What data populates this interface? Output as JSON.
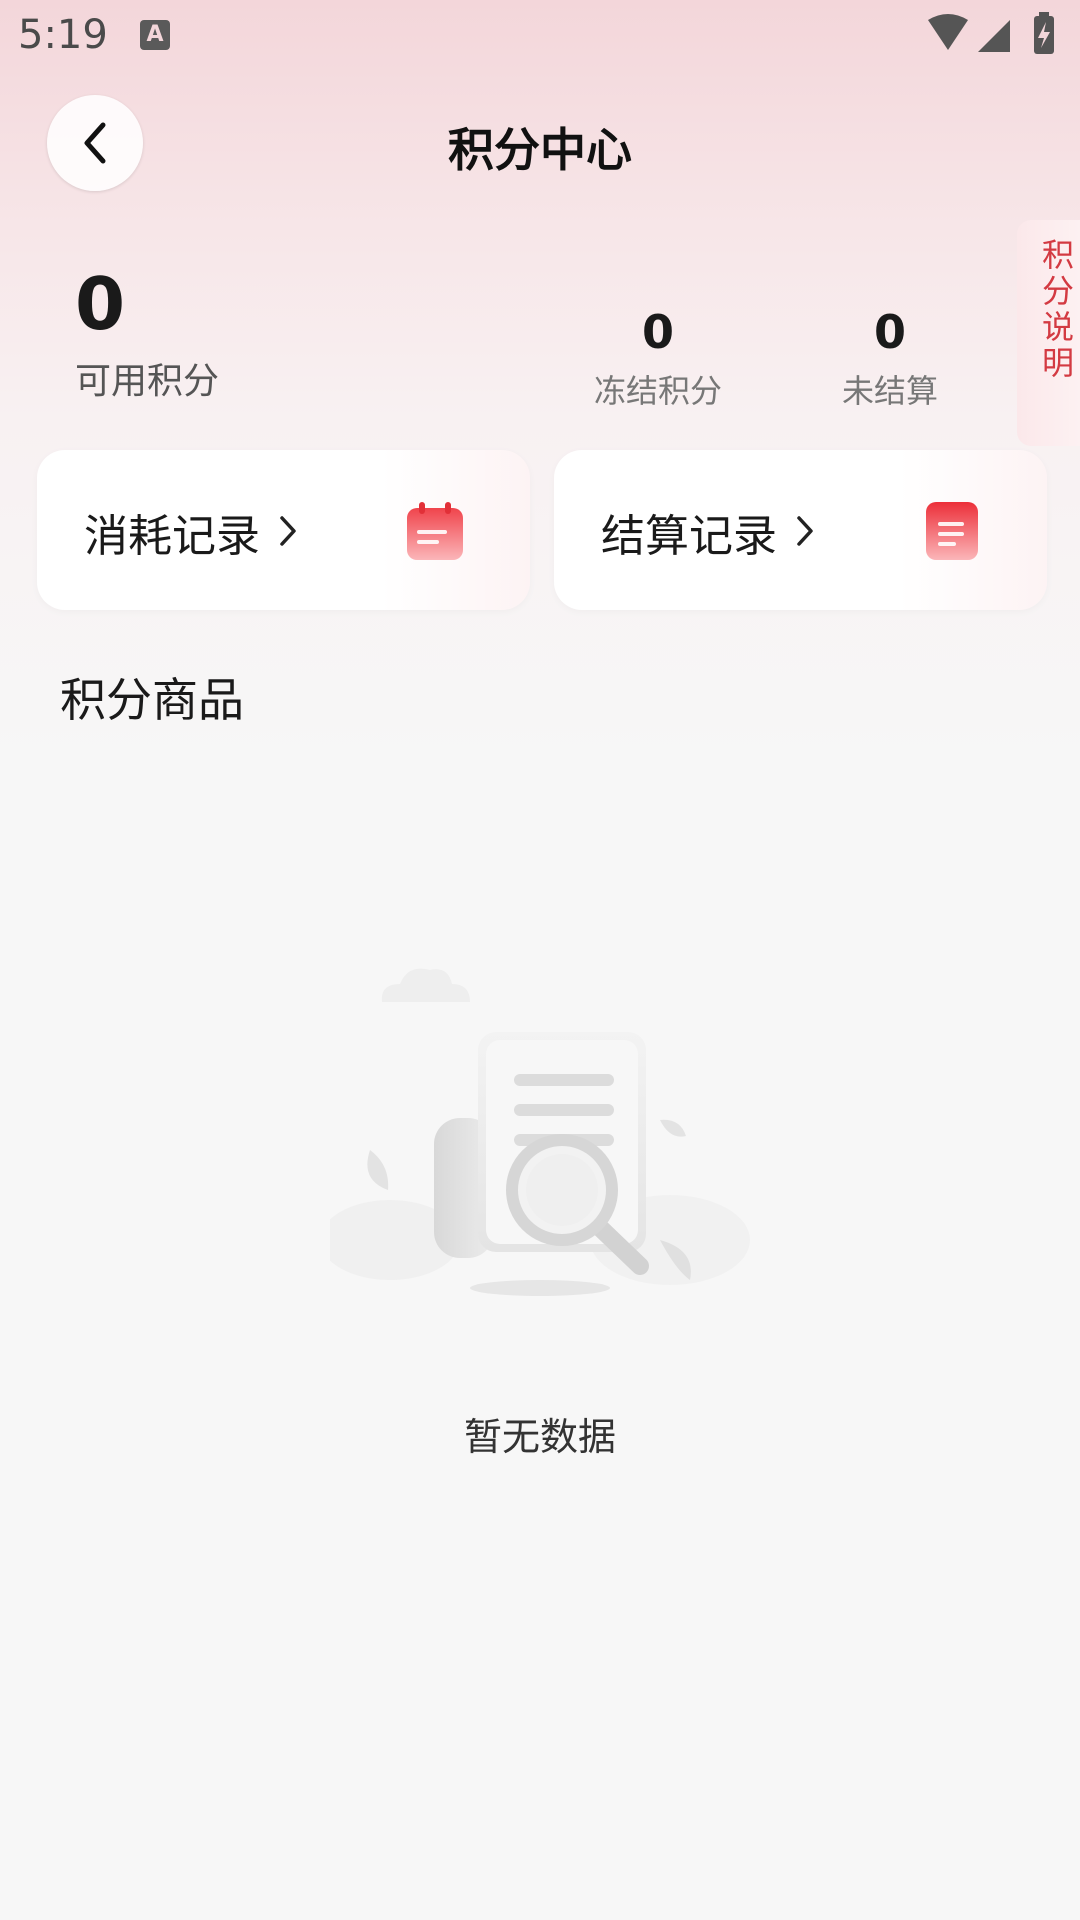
{
  "status_bar": {
    "time": "5:19",
    "notification_icon": "A",
    "icons": [
      "wifi-icon",
      "signal-icon",
      "battery-charging-icon"
    ]
  },
  "header": {
    "title": "积分中心",
    "back_icon": "chevron-left-icon"
  },
  "points": {
    "available_value": "0",
    "available_label": "可用积分",
    "frozen_value": "0",
    "frozen_label": "冻结积分",
    "unsettled_value": "0",
    "unsettled_label": "未结算"
  },
  "explain_tab": {
    "label": "积分说明"
  },
  "cards": {
    "consume": {
      "label": "消耗记录",
      "icon": "calendar-icon"
    },
    "settle": {
      "label": "结算记录",
      "icon": "document-icon"
    }
  },
  "section": {
    "title": "积分商品"
  },
  "empty": {
    "text": "暂无数据",
    "illustration": "empty-search-document-icon"
  },
  "colors": {
    "accent": "#d33a42",
    "header_gradient_top": "#f3d6da",
    "background": "#f7f7f7"
  }
}
